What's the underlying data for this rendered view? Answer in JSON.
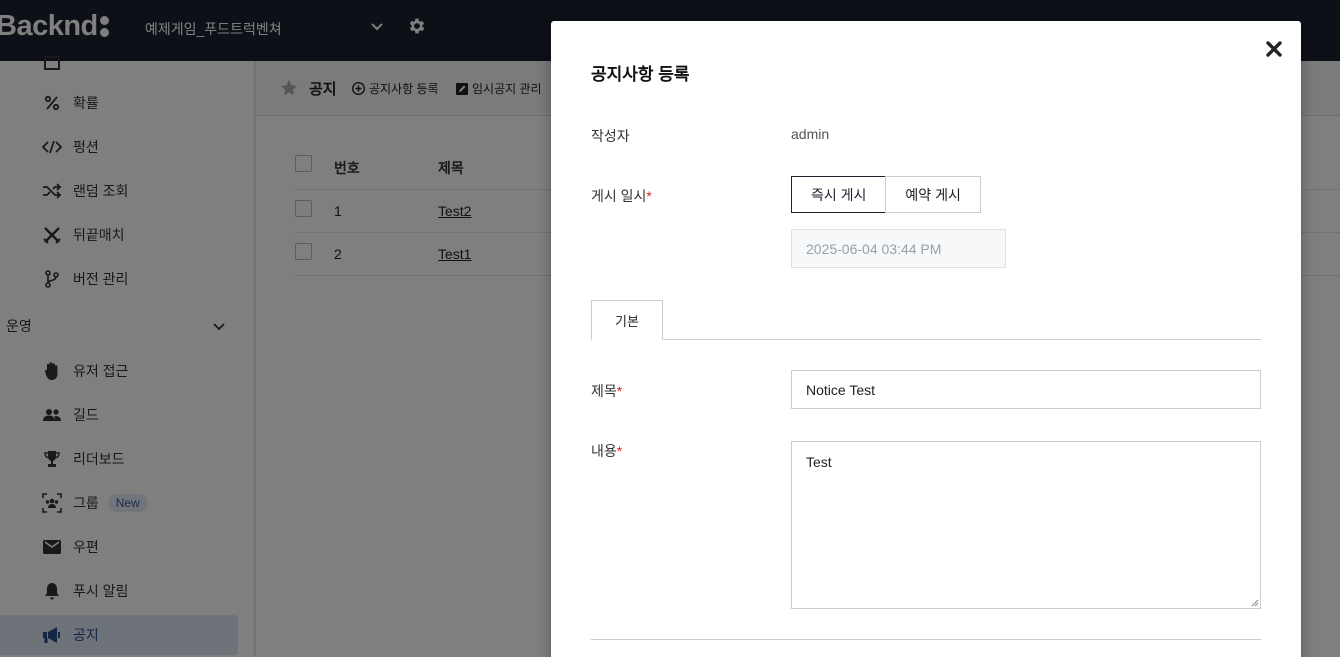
{
  "topbar": {
    "logo_text": "Backnd",
    "project_name": "예제게임_푸드트럭벤쳐",
    "icons": {
      "dropdown": "chevron-down-icon",
      "settings": "gear-icon"
    },
    "background_color": "#1c2130"
  },
  "sidebar": {
    "items_top": [
      {
        "label": "확률",
        "icon": "percent-icon"
      },
      {
        "label": "펑션",
        "icon": "code-icon"
      },
      {
        "label": "랜덤 조회",
        "icon": "shuffle-icon"
      },
      {
        "label": "뒤끝매치",
        "icon": "swords-icon"
      },
      {
        "label": "버전 관리",
        "icon": "branch-icon"
      }
    ],
    "section_label": "운영",
    "items_ops": [
      {
        "label": "유저 접근",
        "icon": "hand-icon"
      },
      {
        "label": "길드",
        "icon": "users-icon"
      },
      {
        "label": "리더보드",
        "icon": "trophy-icon"
      },
      {
        "label": "그룹",
        "icon": "group-icon",
        "badge": "New"
      },
      {
        "label": "우편",
        "icon": "mail-icon"
      },
      {
        "label": "푸시 알림",
        "icon": "bell-icon"
      },
      {
        "label": "공지",
        "icon": "megaphone-icon"
      }
    ],
    "active_item": "공지"
  },
  "breadcrumb": {
    "title": "공지",
    "links": [
      "공지사항 등록",
      "임시공지 관리"
    ]
  },
  "table": {
    "headers": [
      "번호",
      "제목"
    ],
    "rows": [
      {
        "num": "1",
        "title": "Test2"
      },
      {
        "num": "2",
        "title": "Test1"
      }
    ]
  },
  "modal": {
    "title": "공지사항 등록",
    "author_label": "작성자",
    "author_value": "admin",
    "post_time_label": "게시 일시",
    "post_buttons": [
      "즉시 게시",
      "예약 게시"
    ],
    "selected_post_button": "즉시 게시",
    "datetime_value": "2025-06-04 03:44 PM",
    "tab_label": "기본",
    "subject_label": "제목",
    "subject_value": "Notice Test",
    "content_label": "내용",
    "content_value": "Test",
    "required_marker": "*",
    "required_color": "#d62020"
  }
}
